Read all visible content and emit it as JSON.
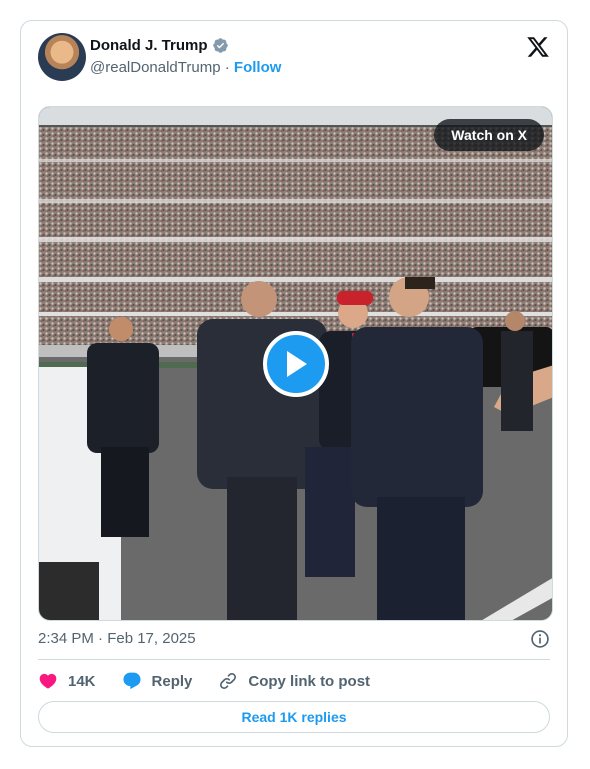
{
  "author": {
    "name": "Donald J. Trump",
    "handle": "@realDonaldTrump",
    "separator": "·",
    "follow_label": "Follow",
    "verified": true
  },
  "media": {
    "watch_label": "Watch on X"
  },
  "meta": {
    "timestamp": "2:34 PM · Feb 17, 2025"
  },
  "actions": {
    "like_count": "14K",
    "reply_label": "Reply",
    "copy_label": "Copy link to post"
  },
  "read_replies_label": "Read 1K replies",
  "colors": {
    "accent": "#1d9bf0",
    "like": "#f91880",
    "muted": "#536471",
    "border": "#cfd9de"
  },
  "icons": [
    "verified-badge-icon",
    "x-logo-icon",
    "play-icon",
    "info-icon",
    "heart-icon",
    "reply-bubble-icon",
    "link-icon"
  ]
}
